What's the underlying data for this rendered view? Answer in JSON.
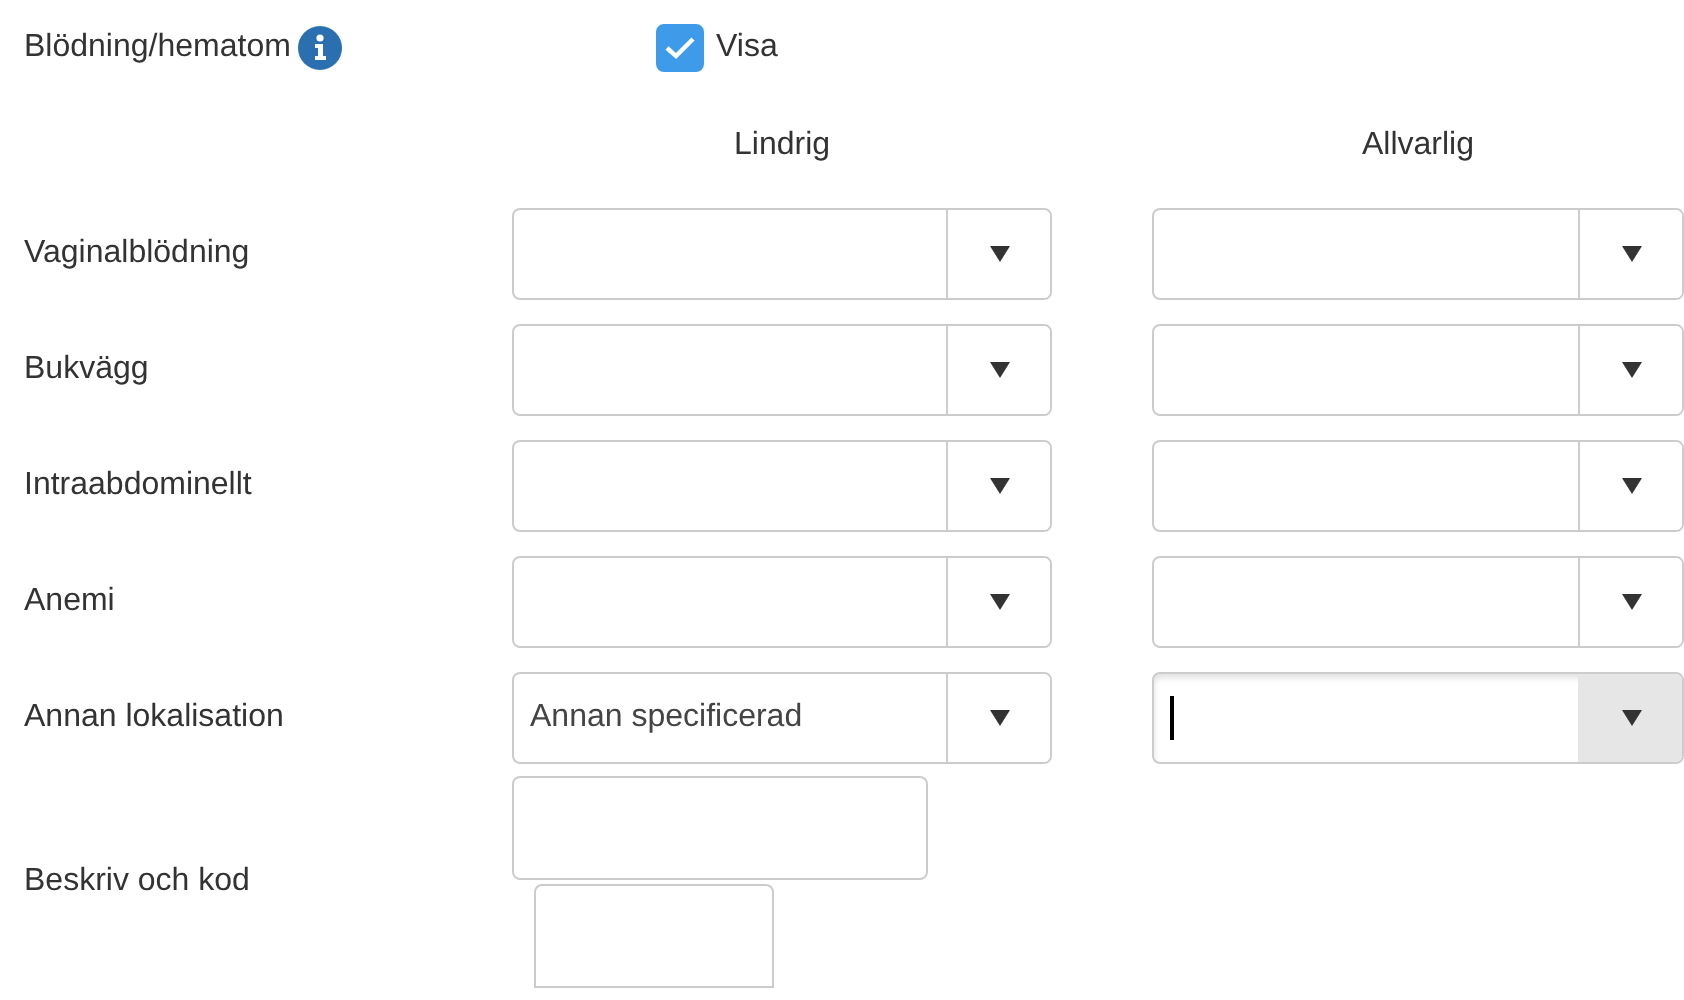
{
  "section": {
    "title": "Blödning/hematom",
    "show": {
      "label": "Visa",
      "checked": true
    }
  },
  "columns": [
    "Lindrig",
    "Allvarlig"
  ],
  "rows": [
    {
      "label": "Vaginalblödning",
      "selects": [
        {
          "focused": false
        },
        {
          "focused": false
        }
      ]
    },
    {
      "label": "Bukvägg",
      "selects": [
        {
          "focused": false
        },
        {
          "focused": false
        }
      ]
    },
    {
      "label": "Intraabdominellt",
      "selects": [
        {
          "focused": false
        },
        {
          "focused": false
        }
      ]
    },
    {
      "label": "Anemi",
      "selects": [
        {
          "focused": false
        },
        {
          "focused": false
        }
      ]
    },
    {
      "label": "Annan lokalisation",
      "selects": [
        {
          "value": "Annan specificerad",
          "focused": false
        },
        {
          "focused": true
        }
      ]
    }
  ],
  "describe": {
    "label": "Beskriv och kod",
    "inputs": [
      {
        "kind": "text"
      },
      {
        "kind": "code"
      }
    ]
  }
}
